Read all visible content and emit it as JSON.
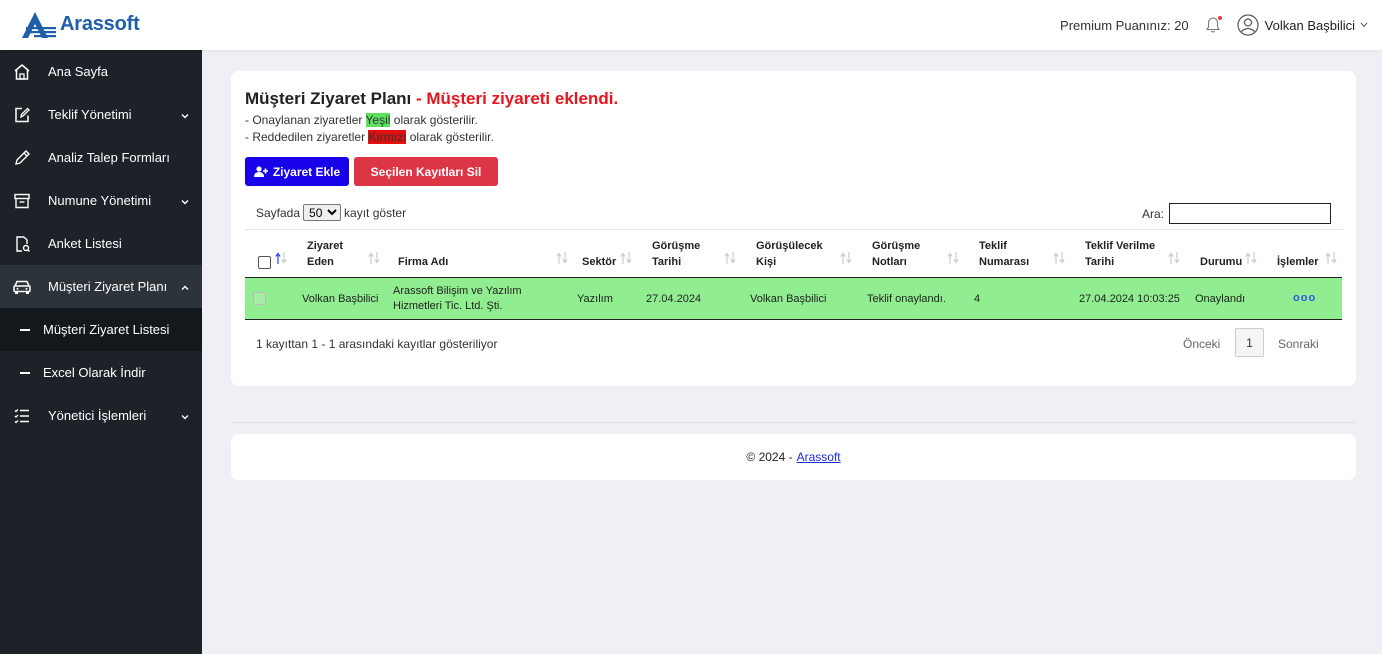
{
  "brand": {
    "name": "Arassoft"
  },
  "topbar": {
    "premium_text": "Premium Puanınız: 20",
    "user_name": "Volkan Başbilici"
  },
  "sidebar": {
    "items": [
      {
        "label": "Ana Sayfa",
        "icon": "home-icon"
      },
      {
        "label": "Teklif Yönetimi",
        "icon": "edit-square-icon"
      },
      {
        "label": "Analiz Talep Formları",
        "icon": "pencil-icon"
      },
      {
        "label": "Numune Yönetimi",
        "icon": "archive-icon"
      },
      {
        "label": "Anket Listesi",
        "icon": "survey-icon"
      },
      {
        "label": "Müşteri Ziyaret Planı",
        "icon": "car-icon"
      },
      {
        "label": "Müşteri Ziyaret Listesi",
        "icon": "dash"
      },
      {
        "label": "Excel Olarak İndir",
        "icon": "dash"
      },
      {
        "label": "Yönetici İşlemleri",
        "icon": "list-icon"
      }
    ]
  },
  "page": {
    "title": "Müşteri Ziyaret Planı",
    "alert": " - Müşteri ziyareti eklendi.",
    "note1_pre": "- Onaylanan ziyaretler ",
    "note1_hl": "Yeşil",
    "note1_post": " olarak gösterilir.",
    "note2_pre": "- Reddedilen ziyaretler ",
    "note2_hl": "Kırmızı",
    "note2_post": " olarak gösterilir.",
    "add_button": "Ziyaret Ekle",
    "delete_button": "Seçilen Kayıtları Sil",
    "length_pre": "Sayfada",
    "length_value": "50",
    "length_post": "kayıt göster",
    "search_label": "Ara:"
  },
  "table": {
    "headers": {
      "ziyaret_eden_1": "Ziyaret",
      "ziyaret_eden_2": "Eden",
      "firma": "Firma Adı",
      "sektor": "Sektör",
      "gorusme_tarihi_1": "Görüşme",
      "gorusme_tarihi_2": "Tarihi",
      "gorusulecek_1": "Görüşülecek",
      "gorusulecek_2": "Kişi",
      "notlar_1": "Görüşme",
      "notlar_2": "Notları",
      "teklif_no_1": "Teklif",
      "teklif_no_2": "Numarası",
      "teklif_tarihi_1": "Teklif Verilme",
      "teklif_tarihi_2": "Tarihi",
      "durum": "Durumu",
      "islemler": "İşlemler"
    },
    "rows": [
      {
        "ziyaret_eden": "Volkan Başbilici",
        "firma_1": "Arassoft Bilişim ve Yazılım",
        "firma_2": "Hizmetleri Tic. Ltd. Şti.",
        "sektor": "Yazılım",
        "gorusme_tarihi": "27.04.2024",
        "gorusulecek": "Volkan Başbilici",
        "notlar": "Teklif onaylandı.",
        "teklif_no": "4",
        "teklif_tarihi": "27.04.2024 10:03:25",
        "durum": "Onaylandı",
        "islemler": "ooo",
        "status_color": "#90ee90"
      }
    ],
    "info": "1 kayıttan 1 - 1 arasındaki kayıtlar gösteriliyor",
    "prev": "Önceki",
    "page": "1",
    "next": "Sonraki"
  },
  "footer": {
    "text": "© 2024 -",
    "link": "Arassoft"
  },
  "colors": {
    "brand": "#1f5fa8",
    "sidebar": "#1c2228",
    "primary_button": "#1800e8",
    "danger_button": "#dc3545",
    "alert_text": "#e8141e",
    "approved_row": "#90ee90"
  }
}
